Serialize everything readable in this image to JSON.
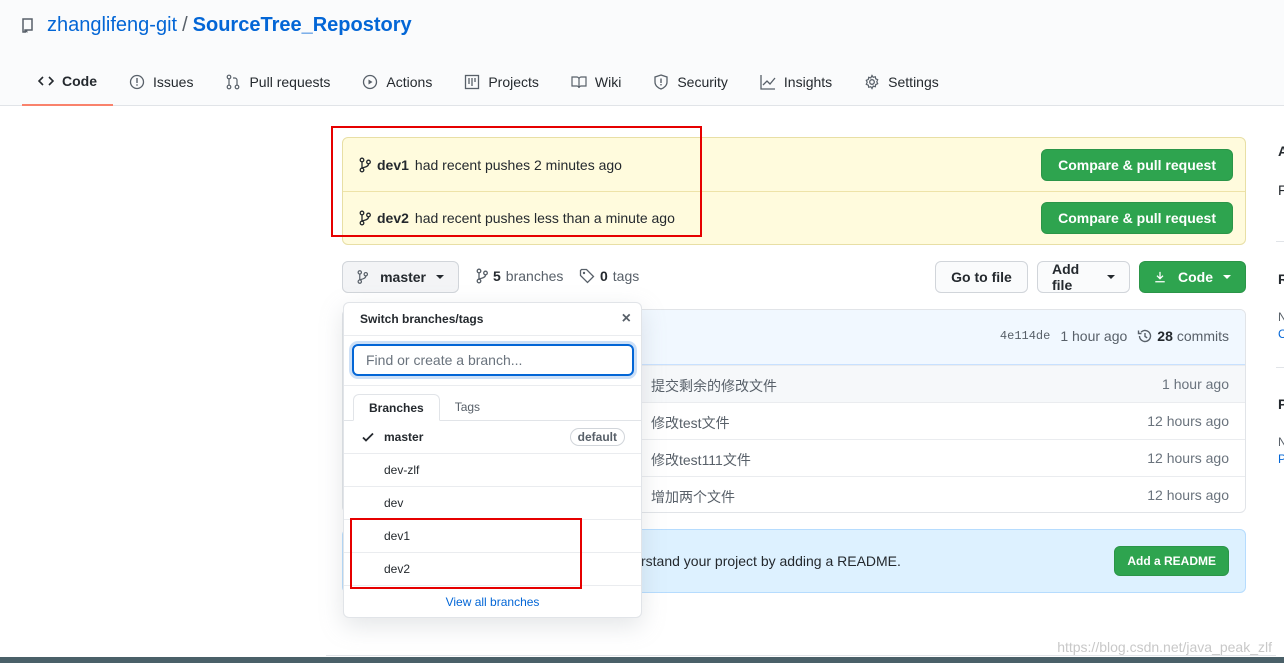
{
  "repo": {
    "owner": "zhanglifeng-git",
    "separator": "/",
    "name": "SourceTree_Repostory"
  },
  "tabs": [
    {
      "label": "Code",
      "icon": "code-icon"
    },
    {
      "label": "Issues",
      "icon": "issue-icon"
    },
    {
      "label": "Pull requests",
      "icon": "pull-request-icon"
    },
    {
      "label": "Actions",
      "icon": "play-icon"
    },
    {
      "label": "Projects",
      "icon": "project-icon"
    },
    {
      "label": "Wiki",
      "icon": "book-icon"
    },
    {
      "label": "Security",
      "icon": "shield-icon"
    },
    {
      "label": "Insights",
      "icon": "graph-icon"
    },
    {
      "label": "Settings",
      "icon": "gear-icon"
    }
  ],
  "recent_pushes": [
    {
      "branch": "dev1",
      "text": "had recent pushes 2 minutes ago",
      "button": "Compare & pull request"
    },
    {
      "branch": "dev2",
      "text": "had recent pushes less than a minute ago",
      "button": "Compare & pull request"
    }
  ],
  "branch_bar": {
    "current_branch": "master",
    "branch_count": "5",
    "branch_label": "branches",
    "tag_count": "0",
    "tag_label": "tags",
    "go_to_file": "Go to file",
    "add_file": "Add file",
    "code": "Code"
  },
  "latest_commit": {
    "sha": "4e114de",
    "time": "1 hour ago",
    "commit_count": "28",
    "commit_label": "commits"
  },
  "files": [
    {
      "message": "提交剩余的修改文件",
      "time": "1 hour ago"
    },
    {
      "message": "修改test文件",
      "time": "12 hours ago"
    },
    {
      "message": "修改test111文件",
      "time": "12 hours ago"
    },
    {
      "message": "增加两个文件",
      "time": "12 hours ago"
    }
  ],
  "readme": {
    "text": "rstand your project by adding a README.",
    "button": "Add a README"
  },
  "dropdown": {
    "title": "Switch branches/tags",
    "close": "×",
    "placeholder": "Find or create a branch...",
    "tabs": [
      "Branches",
      "Tags"
    ],
    "branches": [
      {
        "name": "master",
        "badge": "default"
      },
      {
        "name": "dev-zlf"
      },
      {
        "name": "dev"
      },
      {
        "name": "dev1"
      },
      {
        "name": "dev2"
      }
    ],
    "footer": "View all branches"
  },
  "sidebar_letters": [
    "A",
    "F",
    "R",
    "N",
    "C",
    "P",
    "N",
    "P"
  ],
  "watermark": "https://blog.csdn.net/java_peak_zlf",
  "colors": {
    "link": "#0366d6",
    "green": "#2ea44f",
    "highlight_box": "#e60000",
    "push_banner": "#fffbdd"
  }
}
